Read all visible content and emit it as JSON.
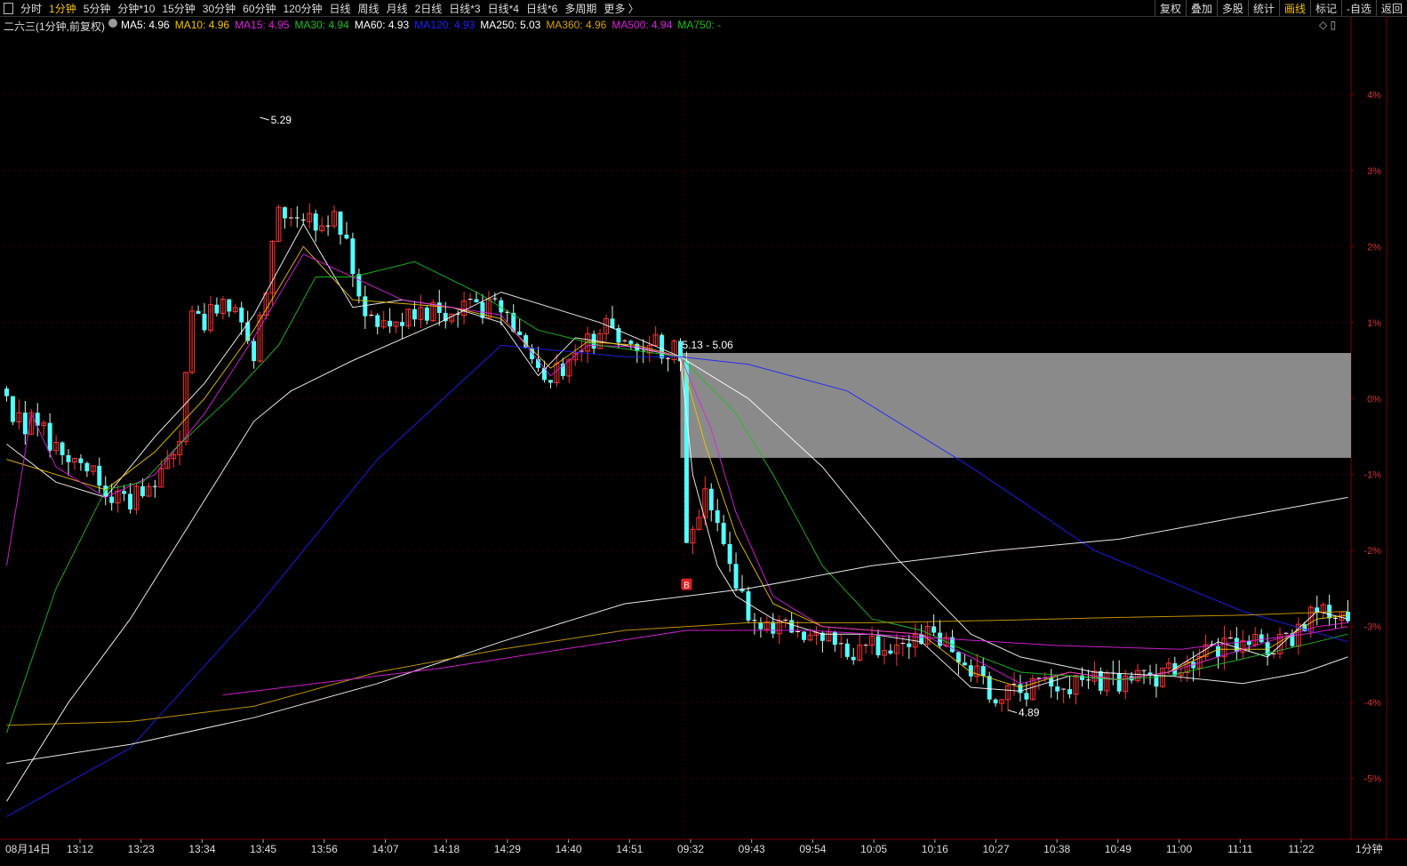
{
  "toolbar": {
    "periods": [
      {
        "label": "分时",
        "active": false
      },
      {
        "label": "1分钟",
        "active": true
      },
      {
        "label": "5分钟",
        "active": false
      },
      {
        "label": "分钟*10",
        "active": false
      },
      {
        "label": "15分钟",
        "active": false
      },
      {
        "label": "30分钟",
        "active": false
      },
      {
        "label": "60分钟",
        "active": false
      },
      {
        "label": "120分钟",
        "active": false
      },
      {
        "label": "日线",
        "active": false
      },
      {
        "label": "周线",
        "active": false
      },
      {
        "label": "月线",
        "active": false
      },
      {
        "label": "2日线",
        "active": false
      },
      {
        "label": "日线*3",
        "active": false
      },
      {
        "label": "日线*4",
        "active": false
      },
      {
        "label": "日线*6",
        "active": false
      },
      {
        "label": "多周期",
        "active": false
      },
      {
        "label": "更多 〉",
        "active": false
      }
    ],
    "right_buttons": [
      {
        "label": "复权",
        "active": false
      },
      {
        "label": "叠加",
        "active": false
      },
      {
        "label": "多股",
        "active": false
      },
      {
        "label": "统计",
        "active": false
      },
      {
        "label": "画线",
        "active": true
      },
      {
        "label": "标记",
        "active": false
      },
      {
        "label": "-自选",
        "active": false
      },
      {
        "label": "返回",
        "active": false
      }
    ]
  },
  "legend": {
    "title": "二六三(1分钟,前复权)",
    "items": [
      {
        "label": "MA5: 4.96",
        "color": "#ffffff"
      },
      {
        "label": "MA10: 4.96",
        "color": "#f5c400"
      },
      {
        "label": "MA15: 4.95",
        "color": "#e020e0"
      },
      {
        "label": "MA30: 4.94",
        "color": "#20c020"
      },
      {
        "label": "MA60: 4.93",
        "color": "#ffffff"
      },
      {
        "label": "MA120: 4.93",
        "color": "#2020ff"
      },
      {
        "label": "MA250: 5.03",
        "color": "#ffffff"
      },
      {
        "label": "MA360: 4.96",
        "color": "#d4a000"
      },
      {
        "label": "MA500: 4.94",
        "color": "#e020e0"
      },
      {
        "label": "MA750: -",
        "color": "#20c020"
      }
    ]
  },
  "corner_icons": "◇ ▯",
  "footer_period": "1分钟",
  "colors": {
    "up": "#ff3232",
    "down": "#54ffff",
    "grid": "#7a0000",
    "axis_text_red": "#d83030",
    "zone_fill": "#8a8a8a"
  },
  "chart_data": {
    "type": "candlestick",
    "title": "二六三(1分钟,前复权)",
    "y_axis": {
      "unit": "%",
      "ticks": [
        "4%",
        "3%",
        "2%",
        "1%",
        "0%",
        "-1%",
        "-2%",
        "-3%",
        "-4%",
        "-5%"
      ],
      "tick_values": [
        4,
        3,
        2,
        1,
        0,
        -1,
        -2,
        -3,
        -4,
        -5
      ],
      "range": [
        -5.8,
        4.8
      ],
      "grid": true
    },
    "x_axis": {
      "labels": [
        "08月14日",
        "13:12",
        "13:23",
        "13:34",
        "13:45",
        "13:56",
        "14:07",
        "14:18",
        "14:29",
        "14:40",
        "14:51",
        "09:32",
        "09:43",
        "09:54",
        "10:05",
        "10:16",
        "10:27",
        "10:38",
        "10:49",
        "11:00",
        "11:11",
        "11:22"
      ]
    },
    "annotations": [
      {
        "text": "5.29",
        "kind": "high",
        "bar": 41,
        "value": 3.7
      },
      {
        "text": "4.89",
        "kind": "low",
        "bar": 162,
        "value": -4.1
      },
      {
        "text": "5.13 - 5.06",
        "kind": "zone",
        "from_bar": 109,
        "y_top": 0.6,
        "y_bottom": -0.78
      },
      {
        "text": "B",
        "kind": "buy",
        "bar": 110,
        "value": -2.45
      }
    ],
    "series_anchor_points": [
      {
        "name": "MA5",
        "color": "#ffffff",
        "points": [
          [
            0,
            -0.6
          ],
          [
            8,
            -1.1
          ],
          [
            16,
            -1.3
          ],
          [
            24,
            -0.5
          ],
          [
            32,
            0.2
          ],
          [
            40,
            1.1
          ],
          [
            48,
            2.3
          ],
          [
            56,
            1.2
          ],
          [
            64,
            1.3
          ],
          [
            72,
            1.2
          ],
          [
            80,
            1.0
          ],
          [
            86,
            0.3
          ],
          [
            92,
            0.8
          ],
          [
            100,
            0.7
          ],
          [
            109,
            0.55
          ],
          [
            111,
            -1.0
          ],
          [
            115,
            -2.2
          ],
          [
            118,
            -2.6
          ],
          [
            124,
            -2.9
          ],
          [
            132,
            -3.1
          ],
          [
            140,
            -3.1
          ],
          [
            148,
            -3.2
          ],
          [
            156,
            -3.8
          ],
          [
            164,
            -3.85
          ],
          [
            172,
            -3.65
          ],
          [
            180,
            -3.7
          ],
          [
            188,
            -3.6
          ],
          [
            196,
            -3.2
          ],
          [
            204,
            -3.4
          ],
          [
            212,
            -2.8
          ],
          [
            217,
            -2.9
          ]
        ]
      },
      {
        "name": "MA10",
        "color": "#f5c400",
        "points": [
          [
            0,
            -0.8
          ],
          [
            8,
            -1.0
          ],
          [
            16,
            -1.2
          ],
          [
            24,
            -0.7
          ],
          [
            32,
            0.0
          ],
          [
            40,
            0.9
          ],
          [
            48,
            2.0
          ],
          [
            56,
            1.3
          ],
          [
            64,
            1.25
          ],
          [
            72,
            1.2
          ],
          [
            80,
            1.05
          ],
          [
            88,
            0.4
          ],
          [
            94,
            0.75
          ],
          [
            102,
            0.7
          ],
          [
            109,
            0.55
          ],
          [
            113,
            -0.6
          ],
          [
            118,
            -1.8
          ],
          [
            124,
            -2.7
          ],
          [
            132,
            -3.0
          ],
          [
            140,
            -3.05
          ],
          [
            148,
            -3.1
          ],
          [
            156,
            -3.6
          ],
          [
            164,
            -3.8
          ],
          [
            172,
            -3.6
          ],
          [
            180,
            -3.7
          ],
          [
            188,
            -3.6
          ],
          [
            196,
            -3.3
          ],
          [
            204,
            -3.3
          ],
          [
            212,
            -2.9
          ],
          [
            217,
            -2.85
          ]
        ]
      },
      {
        "name": "MA15",
        "color": "#e020e0",
        "points": [
          [
            0,
            -2.2
          ],
          [
            4,
            -0.2
          ],
          [
            8,
            -0.9
          ],
          [
            16,
            -1.3
          ],
          [
            24,
            -1.0
          ],
          [
            32,
            -0.2
          ],
          [
            40,
            0.8
          ],
          [
            48,
            1.9
          ],
          [
            56,
            1.6
          ],
          [
            64,
            1.3
          ],
          [
            72,
            1.2
          ],
          [
            80,
            1.1
          ],
          [
            88,
            0.3
          ],
          [
            94,
            0.7
          ],
          [
            102,
            0.68
          ],
          [
            109,
            0.55
          ],
          [
            114,
            -0.4
          ],
          [
            118,
            -1.5
          ],
          [
            124,
            -2.6
          ],
          [
            132,
            -3.0
          ],
          [
            140,
            -3.05
          ],
          [
            148,
            -3.1
          ],
          [
            156,
            -3.4
          ],
          [
            164,
            -3.75
          ],
          [
            172,
            -3.6
          ],
          [
            180,
            -3.7
          ],
          [
            188,
            -3.6
          ],
          [
            196,
            -3.4
          ],
          [
            204,
            -3.2
          ],
          [
            212,
            -3.0
          ],
          [
            217,
            -2.95
          ]
        ]
      },
      {
        "name": "MA30",
        "color": "#20c020",
        "points": [
          [
            0,
            -4.4
          ],
          [
            8,
            -2.5
          ],
          [
            16,
            -1.2
          ],
          [
            22,
            -1.1
          ],
          [
            28,
            -0.6
          ],
          [
            36,
            0.0
          ],
          [
            44,
            0.7
          ],
          [
            50,
            1.6
          ],
          [
            56,
            1.6
          ],
          [
            66,
            1.8
          ],
          [
            76,
            1.4
          ],
          [
            86,
            0.9
          ],
          [
            96,
            0.7
          ],
          [
            109,
            0.55
          ],
          [
            118,
            -0.2
          ],
          [
            124,
            -1.0
          ],
          [
            132,
            -2.2
          ],
          [
            140,
            -2.9
          ],
          [
            148,
            -3.05
          ],
          [
            156,
            -3.35
          ],
          [
            164,
            -3.6
          ],
          [
            172,
            -3.65
          ],
          [
            180,
            -3.7
          ],
          [
            188,
            -3.65
          ],
          [
            196,
            -3.5
          ],
          [
            204,
            -3.35
          ],
          [
            212,
            -3.2
          ],
          [
            217,
            -3.1
          ]
        ]
      },
      {
        "name": "MA60",
        "color": "#ffffff",
        "points": [
          [
            0,
            -5.3
          ],
          [
            10,
            -4.0
          ],
          [
            20,
            -2.9
          ],
          [
            30,
            -1.6
          ],
          [
            40,
            -0.3
          ],
          [
            46,
            0.1
          ],
          [
            56,
            0.5
          ],
          [
            70,
            1.0
          ],
          [
            80,
            1.4
          ],
          [
            96,
            1.0
          ],
          [
            109,
            0.55
          ],
          [
            120,
            0.0
          ],
          [
            132,
            -0.9
          ],
          [
            144,
            -2.1
          ],
          [
            156,
            -3.1
          ],
          [
            164,
            -3.4
          ],
          [
            176,
            -3.6
          ],
          [
            188,
            -3.65
          ],
          [
            200,
            -3.75
          ],
          [
            210,
            -3.6
          ],
          [
            217,
            -3.4
          ]
        ]
      },
      {
        "name": "MA120",
        "color": "#2020ff",
        "points": [
          [
            0,
            -5.5
          ],
          [
            20,
            -4.6
          ],
          [
            40,
            -2.8
          ],
          [
            60,
            -0.8
          ],
          [
            80,
            0.7
          ],
          [
            100,
            0.55
          ],
          [
            109,
            0.55
          ],
          [
            120,
            0.45
          ],
          [
            136,
            0.1
          ],
          [
            156,
            -0.9
          ],
          [
            176,
            -2.0
          ],
          [
            200,
            -2.8
          ],
          [
            217,
            -3.2
          ]
        ]
      },
      {
        "name": "MA250",
        "color": "#ffffff",
        "points": [
          [
            0,
            -4.8
          ],
          [
            20,
            -4.55
          ],
          [
            40,
            -4.2
          ],
          [
            60,
            -3.75
          ],
          [
            80,
            -3.2
          ],
          [
            100,
            -2.7
          ],
          [
            120,
            -2.5
          ],
          [
            140,
            -2.2
          ],
          [
            160,
            -2.0
          ],
          [
            180,
            -1.85
          ],
          [
            200,
            -1.55
          ],
          [
            217,
            -1.3
          ]
        ]
      },
      {
        "name": "MA360",
        "color": "#d4a000",
        "points": [
          [
            0,
            -4.3
          ],
          [
            20,
            -4.25
          ],
          [
            40,
            -4.05
          ],
          [
            60,
            -3.6
          ],
          [
            80,
            -3.3
          ],
          [
            100,
            -3.05
          ],
          [
            120,
            -2.95
          ],
          [
            140,
            -2.95
          ],
          [
            160,
            -2.92
          ],
          [
            180,
            -2.88
          ],
          [
            200,
            -2.85
          ],
          [
            217,
            -2.8
          ]
        ]
      },
      {
        "name": "MA500",
        "color": "#e020e0",
        "points": [
          [
            35,
            -3.9
          ],
          [
            50,
            -3.75
          ],
          [
            70,
            -3.55
          ],
          [
            90,
            -3.3
          ],
          [
            110,
            -3.05
          ],
          [
            130,
            -3.05
          ],
          [
            150,
            -3.15
          ],
          [
            170,
            -3.25
          ],
          [
            190,
            -3.3
          ],
          [
            210,
            -3.1
          ],
          [
            217,
            -3.0
          ]
        ]
      }
    ],
    "candle_segments": [
      {
        "from": 0,
        "to": 20,
        "start": -0.1,
        "end": -1.4
      },
      {
        "from": 20,
        "to": 28,
        "start": -1.4,
        "end": -0.6
      },
      {
        "from": 28,
        "to": 30,
        "start": -0.6,
        "end": 1.0
      },
      {
        "from": 30,
        "to": 36,
        "start": 1.0,
        "end": 1.2
      },
      {
        "from": 36,
        "to": 40,
        "start": 1.2,
        "end": 0.6
      },
      {
        "from": 40,
        "to": 44,
        "start": 0.6,
        "end": 2.4
      },
      {
        "from": 44,
        "to": 54,
        "start": 2.4,
        "end": 2.3
      },
      {
        "from": 54,
        "to": 58,
        "start": 2.3,
        "end": 1.1
      },
      {
        "from": 58,
        "to": 80,
        "start": 1.1,
        "end": 1.15
      },
      {
        "from": 80,
        "to": 88,
        "start": 1.15,
        "end": 0.2
      },
      {
        "from": 88,
        "to": 96,
        "start": 0.2,
        "end": 0.9
      },
      {
        "from": 96,
        "to": 109,
        "start": 0.9,
        "end": 0.6
      },
      {
        "from": 109,
        "to": 110,
        "start": 0.6,
        "end": -1.9
      },
      {
        "from": 110,
        "to": 113,
        "start": -1.9,
        "end": -1.2
      },
      {
        "from": 113,
        "to": 120,
        "start": -1.2,
        "end": -2.9
      },
      {
        "from": 120,
        "to": 128,
        "start": -2.9,
        "end": -3.0
      },
      {
        "from": 128,
        "to": 136,
        "start": -3.0,
        "end": -3.3
      },
      {
        "from": 136,
        "to": 150,
        "start": -3.3,
        "end": -3.1
      },
      {
        "from": 150,
        "to": 160,
        "start": -3.1,
        "end": -3.9
      },
      {
        "from": 160,
        "to": 170,
        "start": -3.9,
        "end": -3.8
      },
      {
        "from": 170,
        "to": 185,
        "start": -3.8,
        "end": -3.7
      },
      {
        "from": 185,
        "to": 195,
        "start": -3.7,
        "end": -3.3
      },
      {
        "from": 195,
        "to": 208,
        "start": -3.3,
        "end": -3.2
      },
      {
        "from": 208,
        "to": 212,
        "start": -3.2,
        "end": -2.7
      },
      {
        "from": 212,
        "to": 217,
        "start": -2.7,
        "end": -2.9
      }
    ]
  }
}
